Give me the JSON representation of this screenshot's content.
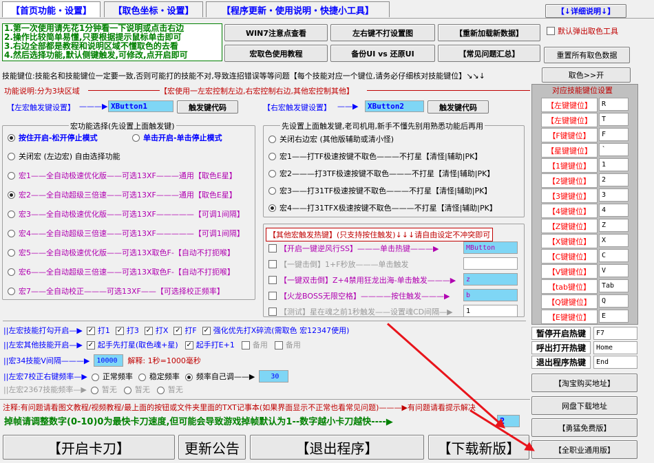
{
  "tabs": [
    "【首页功能・设置】",
    "【取色坐标・设置】",
    "【程序更新・使用说明・快捷小工具】"
  ],
  "detail_button": "【↓详细说明↓】",
  "instructions": [
    "1.第一次使用请先花1分钟看一下说明或点击右边",
    "2.操作比较简单易懂,只要根据提示鼠标单击即可",
    "3.右边全部都是教程和说明区域不懂取色的去看",
    "4.然后选择功能,默认侧键触发,可修改,点开启即可"
  ],
  "top_buttons": {
    "win7": "WIN7注意点查看",
    "lr_key": "左右键不打设置图",
    "reload": "【重新加载新数据】",
    "macro_color": "宏取色使用教程",
    "backup": "备份UI vs 还原UI",
    "faq": "【常见问题汇总】",
    "reset_all": "重置所有取色数据",
    "color_open": "取色>>开"
  },
  "default_popup": "默认弹出取色工具",
  "key_notice": "技能键位:技能名和技能键位一定要一致,否则可能打的技能不对,导致连招错误等等问题【每个技能对应一个键位,请务必仔细核对技能键位】↘↘↓",
  "func_desc_left": "功能说明:分为3块区域",
  "func_desc_right": "【宏使用一左宏控制左边,右宏控制右边,其他宏控制其他】",
  "left_trigger": {
    "label": "【左宏触发键设置】",
    "arrow": "———▶",
    "value": "XButton1",
    "button": "触发键代码"
  },
  "right_trigger": {
    "label": "【右宏触发键设置】",
    "arrow": "——▶",
    "value": "XButton2",
    "button": "触发键代码"
  },
  "left_group": {
    "title": "宏功能选择(先设置上面触发键)",
    "mode_hold": "按住开启-松开停止模式",
    "mode_click": "单击开启-单击停止模式",
    "options": [
      {
        "text": "关闭宏 (左边宏) 自由选择功能",
        "on": false
      },
      {
        "text": "宏1——全自动极速优化版——可选13XF———通用【取色E星】",
        "on": false
      },
      {
        "text": "宏2——全自动超级三倍速——可选13XF———通用【取色E星】",
        "on": true
      },
      {
        "text": "宏3——全自动极速优化版——可选13XF—————【可调1间隔】",
        "on": false
      },
      {
        "text": "宏4——全自动超级三倍速——可选13XF—————【可调1间隔】",
        "on": false
      },
      {
        "text": "宏5——全自动极速优化版——可选13X取色F-【自动不打扼喉】",
        "on": false
      },
      {
        "text": "宏6——全自动超级三倍速——可选13X取色F-【自动不打扼喉】",
        "on": false
      },
      {
        "text": "宏7——全自动校正———可选13XF——【可选择校正频率】",
        "on": false
      }
    ]
  },
  "right_group": {
    "title": "先设置上面触发键,老司机用,新手不懂先别用熟悉功能后再用",
    "options": [
      {
        "text": "关闭右边宏 (其他版辅助或清小怪)",
        "on": false
      },
      {
        "text": "宏1——打TF极速按键不取色———不打星【清怪|辅助|PK】",
        "on": false
      },
      {
        "text": "宏2———打3TF极速按键不取色———不打星【清怪|辅助|PK】",
        "on": false
      },
      {
        "text": "宏3——打31TF极速按键不取色———不打星【清怪|辅助|PK】",
        "on": false
      },
      {
        "text": "宏4——打31TFX极速按键不取色———不打星【清怪|辅助|PK】",
        "on": true
      }
    ]
  },
  "other_hotkeys": {
    "title": "【其他宏触发热键】(只支持按住触发)↓↓↓请自由设定不冲突即可",
    "rows": [
      {
        "text": "【开启一键逆风行SS】",
        "mid": "———单击热键———▶",
        "value": "MButton",
        "field": "cyan",
        "style": "red",
        "checked": false
      },
      {
        "text": "【一键击倒】1+F秒放",
        "mid": "———单击触发",
        "value": "",
        "field": "white",
        "style": "gray",
        "checked": false
      },
      {
        "text": "【一键双击倒】Z+4禁用狂龙出海-单击触发",
        "mid": "———▶",
        "value": "z",
        "field": "cyan",
        "style": "red",
        "checked": false
      },
      {
        "text": "【火龙BOSS无限空格】",
        "mid": "————按住触发———▶",
        "value": "b",
        "field": "cyan",
        "style": "red",
        "checked": false
      },
      {
        "text": "【测试】星在魂之前1秒触发——设置魂CD间隔—",
        "mid": "▶",
        "value": "1",
        "field": "white",
        "style": "gray",
        "checked": false
      }
    ]
  },
  "key_panel": {
    "title": "对应技能键位设置",
    "keys": [
      {
        "label": "【左键键位】",
        "value": "R"
      },
      {
        "label": "【左键键位】",
        "value": "T"
      },
      {
        "label": "【F键键位】",
        "value": "F"
      },
      {
        "label": "【星键键位】",
        "value": "`"
      },
      {
        "label": "【1键键位】",
        "value": "1"
      },
      {
        "label": "【2键键位】",
        "value": "2"
      },
      {
        "label": "【3键键位】",
        "value": "3"
      },
      {
        "label": "【4键键位】",
        "value": "4"
      },
      {
        "label": "【Z键键位】",
        "value": "Z"
      },
      {
        "label": "【X键键位】",
        "value": "X"
      },
      {
        "label": "【C键键位】",
        "value": "C"
      },
      {
        "label": "【V键键位】",
        "value": "V"
      },
      {
        "label": "【tab键位】",
        "value": "Tab"
      },
      {
        "label": "【Q键键位】",
        "value": "Q"
      },
      {
        "label": "【E键键位】",
        "value": "E"
      }
    ]
  },
  "hotkeys": [
    {
      "label": "暂停开启热键",
      "value": "F7"
    },
    {
      "label": "呼出打开热键",
      "value": "Home"
    },
    {
      "label": "退出程序热键",
      "value": "End"
    }
  ],
  "settings": {
    "left_hook": {
      "label": "||左宏技能打勾开启—▶",
      "items": [
        {
          "t": "打1",
          "on": true
        },
        {
          "t": "打3",
          "on": true
        },
        {
          "t": "打X",
          "on": true
        },
        {
          "t": "打F",
          "on": true
        },
        {
          "t": "强化优先打X碎流(需取色 宏12347使用)",
          "on": true
        }
      ]
    },
    "left_other": {
      "label": "||左宏其他技能开启—▶",
      "items": [
        {
          "t": "起手先打星(取色魂+星)",
          "on": true
        },
        {
          "t": "起手打E+1",
          "on": true
        },
        {
          "t": "备用",
          "on": false
        },
        {
          "t": "备用",
          "on": false
        }
      ]
    },
    "interval": {
      "label": "||宏34技能V间隔———▶",
      "value": "10000",
      "explain": "解释: 1秒=1000毫秒"
    },
    "left7": {
      "label": "||左宏7校正右键频率—▶",
      "opts": [
        {
          "t": "正常频率",
          "on": false
        },
        {
          "t": "稳定频率",
          "on": false
        },
        {
          "t": "频率自己调——▶",
          "on": true
        }
      ],
      "value": "30"
    },
    "left2367": {
      "label": "||左宏2367技能频率—▶",
      "opts": [
        "暂无",
        "暂无",
        "暂无"
      ]
    }
  },
  "note": "注释:有问题请看图文教程/视频教程/最上面的按钮或文件夹里面的TXT记事本(如果界面显示不正常也看常见问题)———▶有问题请看提示解决",
  "frame_note": "掉帧请调整数字(0-10)0为最快卡刀速度,但可能会导致游戏掉帧默认为1--数字越小卡刀越快----▶",
  "frame_value": "2",
  "bottom_buttons": {
    "start": "【开启卡刀】",
    "update": "更新公告",
    "exit": "【退出程序】",
    "download": "【下载新版】"
  },
  "side_buttons": {
    "taobao": "【淘宝购买地址】",
    "netdisk": "网盘下载地址",
    "brave": "【勇猛免费版】",
    "all_class": "【全职业通用版】"
  },
  "colors": {
    "red": "#ff0000",
    "blue": "#0000ff",
    "green": "#008000",
    "cyan_field": "#7fd6f5",
    "arrow": "#e8141b"
  }
}
